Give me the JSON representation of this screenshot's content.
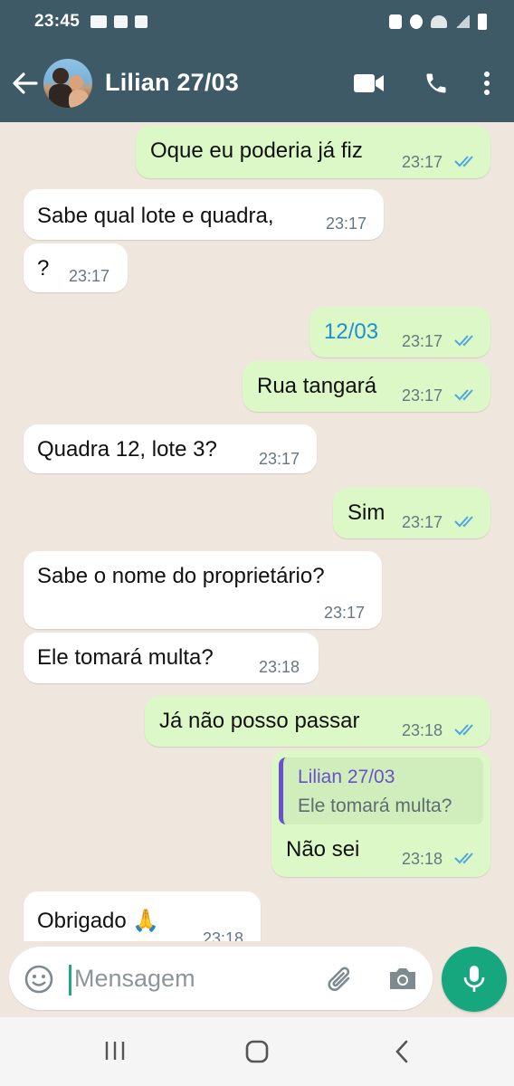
{
  "status": {
    "time": "23:45"
  },
  "header": {
    "contact_name": "Lilian 27/03"
  },
  "messages": [
    {
      "dir": "out",
      "text": "Oque eu poderia já fiz",
      "time": "23:17",
      "read": true
    },
    {
      "dir": "in",
      "text": "Sabe qual lote e quadra,",
      "time": "23:17"
    },
    {
      "dir": "in",
      "text": "?",
      "time": "23:17"
    },
    {
      "dir": "out",
      "text": "12/03",
      "time": "23:17",
      "read": true
    },
    {
      "dir": "out",
      "text": "Rua tangará",
      "time": "23:17",
      "read": true
    },
    {
      "dir": "in",
      "text": "Quadra 12, lote 3?",
      "time": "23:17"
    },
    {
      "dir": "out",
      "text": "Sim",
      "time": "23:17",
      "read": true
    },
    {
      "dir": "in",
      "text": "Sabe o nome do proprietário?",
      "time": "23:17"
    },
    {
      "dir": "in",
      "text": "Ele tomará multa?",
      "time": "23:18"
    },
    {
      "dir": "out",
      "text": "Já não posso passar",
      "time": "23:18",
      "read": true
    },
    {
      "dir": "out",
      "text": "Não sei",
      "time": "23:18",
      "read": true,
      "quote": {
        "author": "Lilian 27/03",
        "text": "Ele tomará multa?"
      }
    },
    {
      "dir": "in",
      "text": "Obrigado 🙏",
      "time": "23:18"
    }
  ],
  "input": {
    "placeholder": "Mensagem"
  },
  "colors": {
    "header": "#3e5a66",
    "outgoing": "#dcf8c6",
    "incoming": "#ffffff",
    "accent": "#17a77f",
    "tick": "#4fa6e0"
  },
  "icons": [
    "back-arrow-icon",
    "video-call-icon",
    "phone-icon",
    "more-icon",
    "emoji-icon",
    "attach-icon",
    "camera-icon",
    "mic-icon",
    "recents-icon",
    "home-icon",
    "nav-back-icon"
  ]
}
